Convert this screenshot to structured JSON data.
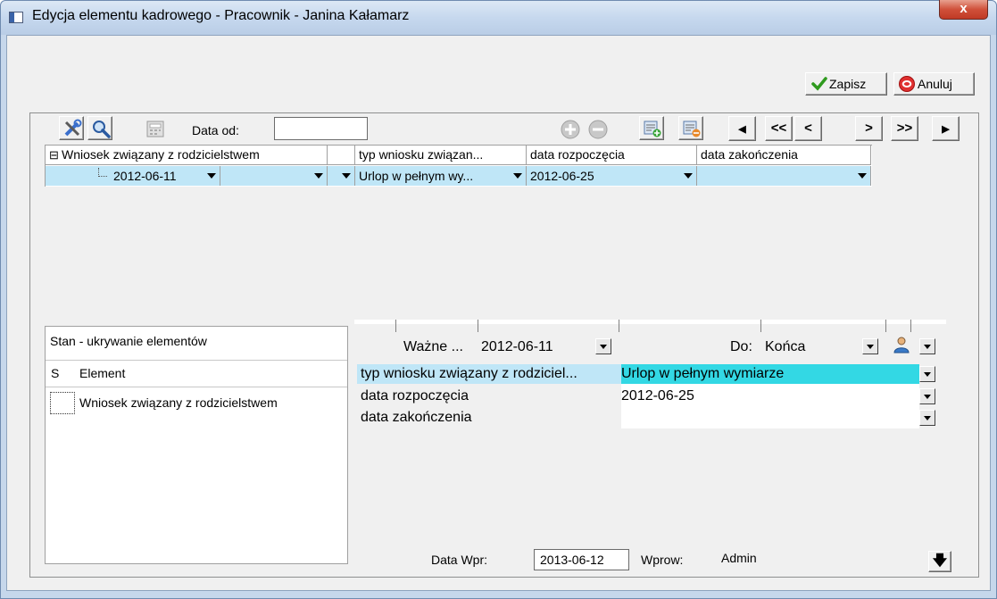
{
  "window": {
    "title": "Edycja elementu kadrowego - Pracownik - Janina Kałamarz",
    "close_glyph": "x"
  },
  "actions": {
    "save_label": "Zapisz",
    "cancel_label": "Anuluj"
  },
  "toolbar": {
    "data_od_label": "Data od:",
    "data_od_value": "",
    "nav": {
      "first": "◀",
      "prev_page": "<<",
      "prev": "<",
      "next": ">",
      "next_page": ">>",
      "last": "▶"
    }
  },
  "grid": {
    "columns": [
      "Wniosek związany z rodzicielstwem",
      "typ wniosku związan...",
      "data rozpoczęcia",
      "data zakończenia"
    ],
    "tree_toggle": "⊟",
    "row": {
      "date": "2012-06-11",
      "typ": "Urlop w pełnym wy...",
      "start": "2012-06-25",
      "end": ""
    }
  },
  "left_panel": {
    "title": "Stan - ukrywanie elementów",
    "header_s": "S",
    "header_element": "Element",
    "items": [
      "Wniosek związany z rodzicielstwem"
    ]
  },
  "detail": {
    "wazne_label": "Ważne ...",
    "wazne_value": "2012-06-11",
    "do_label": "Do:",
    "do_value": "Końca",
    "properties": [
      {
        "name": "typ wniosku związany z rodziciel...",
        "value": "Urlop w pełnym wymiarze"
      },
      {
        "name": "data rozpoczęcia",
        "value": "2012-06-25"
      },
      {
        "name": "data zakończenia",
        "value": ""
      }
    ]
  },
  "footer": {
    "data_wpr_label": "Data Wpr:",
    "data_wpr_value": "2013-06-12",
    "wprow_label": "Wprow:",
    "wprow_value": "Admin",
    "down_glyph": "🡇"
  },
  "colors": {
    "selected_row": "#bfe6f7",
    "highlight_value": "#33d8e4"
  }
}
